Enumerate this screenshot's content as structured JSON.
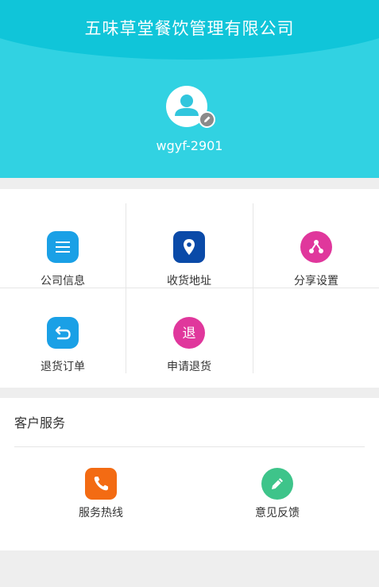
{
  "header": {
    "title": "五味草堂餐饮管理有限公司",
    "username": "wgyf-2901",
    "bg_color": "#31d2e2"
  },
  "menu": [
    {
      "label": "公司信息",
      "icon": "list-icon",
      "color": "#1aa0e6"
    },
    {
      "label": "收货地址",
      "icon": "location-pin-icon",
      "color": "#0a4aa8"
    },
    {
      "label": "分享设置",
      "icon": "share-icon",
      "color": "#e0379c"
    },
    {
      "label": "退货订单",
      "icon": "return-arrow-icon",
      "color": "#1aa0e6"
    },
    {
      "label": "申请退货",
      "icon": "return-char-icon",
      "glyph": "退",
      "color": "#e0379c"
    }
  ],
  "service": {
    "title": "客户服务",
    "items": [
      {
        "label": "服务热线",
        "icon": "phone-icon",
        "color": "#f36b13"
      },
      {
        "label": "意见反馈",
        "icon": "pencil-icon",
        "color": "#3ec48a"
      }
    ]
  }
}
